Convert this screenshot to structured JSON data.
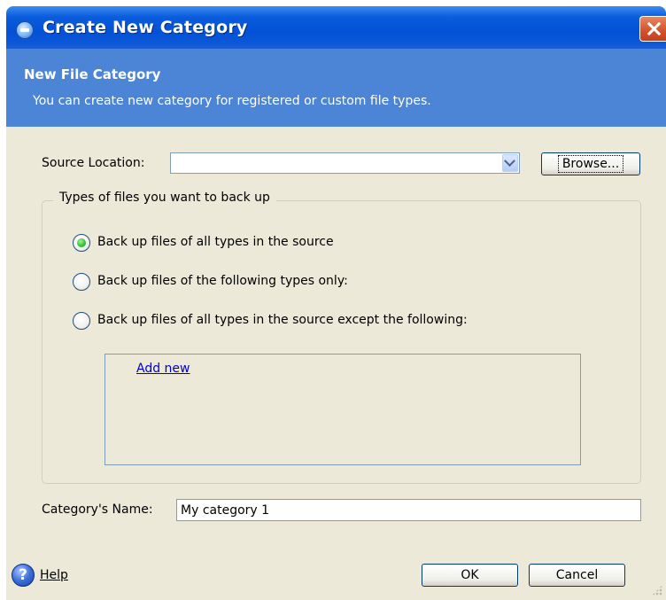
{
  "window": {
    "title": "Create New Category",
    "close_icon": "close-icon"
  },
  "banner": {
    "title": "New File Category",
    "description": "You can create new category for registered or custom file types."
  },
  "source": {
    "label": "Source Location:",
    "value": "",
    "browse_button": "Browse..."
  },
  "types_group": {
    "legend": "Types of files you want to back up",
    "options": [
      {
        "label": "Back up files of all types in the source",
        "checked": true
      },
      {
        "label": "Back up files of the following types only:",
        "checked": false
      },
      {
        "label": "Back up files of all types in the source except the following:",
        "checked": false
      }
    ],
    "list_link": "Add new"
  },
  "category_name": {
    "label": "Category's Name:",
    "value": "My category 1"
  },
  "footer": {
    "help": "Help",
    "ok": "OK",
    "cancel": "Cancel"
  },
  "colors": {
    "titlebar": "#0a5ddd",
    "banner": "#4c84d6",
    "dialog_bg": "#ece9d8",
    "link": "#0000cc",
    "radio_checked": "#35c53a"
  }
}
